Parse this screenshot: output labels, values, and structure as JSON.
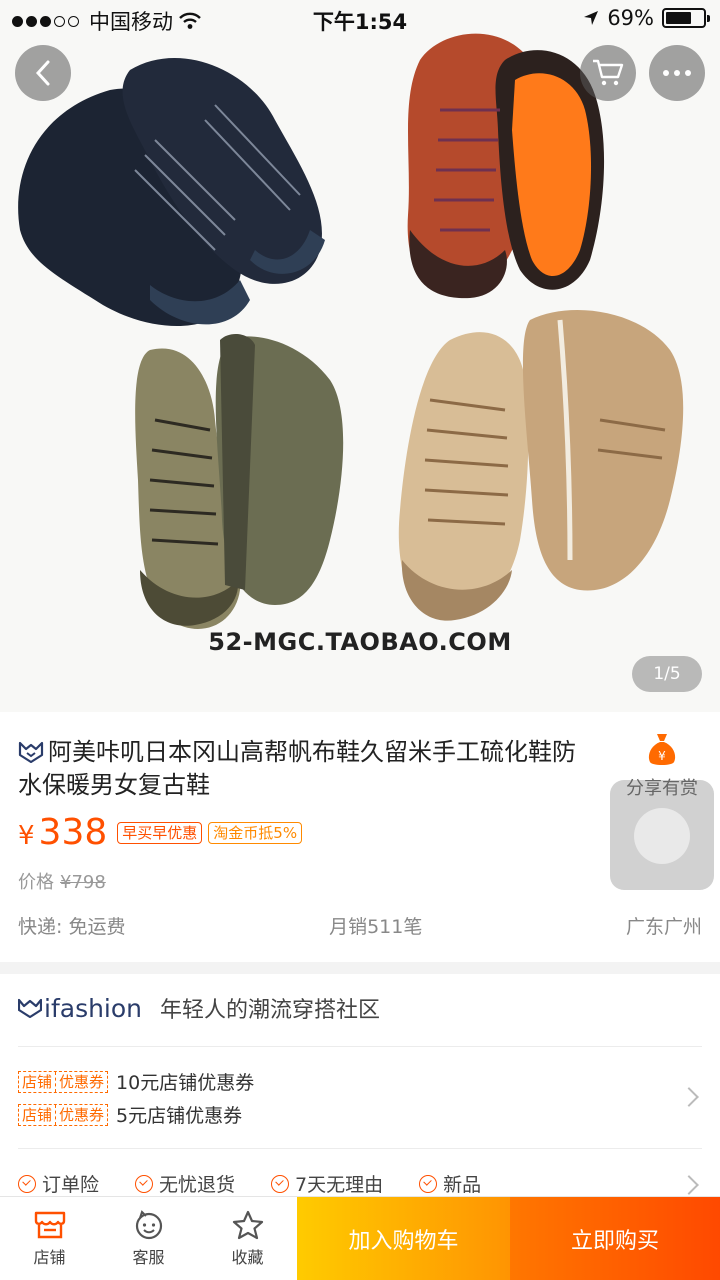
{
  "status_bar": {
    "carrier": "中国移动",
    "time": "下午1:54",
    "battery": "69%",
    "battery_level": 0.69
  },
  "gallery": {
    "watermark": "52-MGC.TAOBAO.COM",
    "pager": "1/5"
  },
  "product": {
    "title": "阿美咔叽日本冈山高帮帆布鞋久留米手工硫化鞋防水保暖男女复古鞋",
    "price_symbol": "¥",
    "price": "338",
    "tag_early": "早买早优惠",
    "tag_coin": "淘金币抵5%",
    "original_label": "价格",
    "original_price": "¥798",
    "shipping": "快递: 免运费",
    "monthly_sales": "月销511笔",
    "location": "广东广州",
    "share_label": "分享有赏",
    "share_coin": "¥"
  },
  "shop": {
    "brand": "ifashion",
    "slogan": "年轻人的潮流穿搭社区",
    "coupons": [
      {
        "tag_a": "店铺",
        "tag_b": "优惠券",
        "text": "10元店铺优惠券"
      },
      {
        "tag_a": "店铺",
        "tag_b": "优惠券",
        "text": "5元店铺优惠券"
      }
    ],
    "services": [
      "订单险",
      "无忧退货",
      "7天无理由",
      "新品"
    ]
  },
  "bottom_bar": {
    "shop": "店铺",
    "service": "客服",
    "favorite": "收藏",
    "add_to_cart": "加入购物车",
    "buy_now": "立即购买"
  },
  "colors": {
    "accent": "#ff5000",
    "cart_button": "#ffb000",
    "buy_button": "#ff5a00"
  }
}
